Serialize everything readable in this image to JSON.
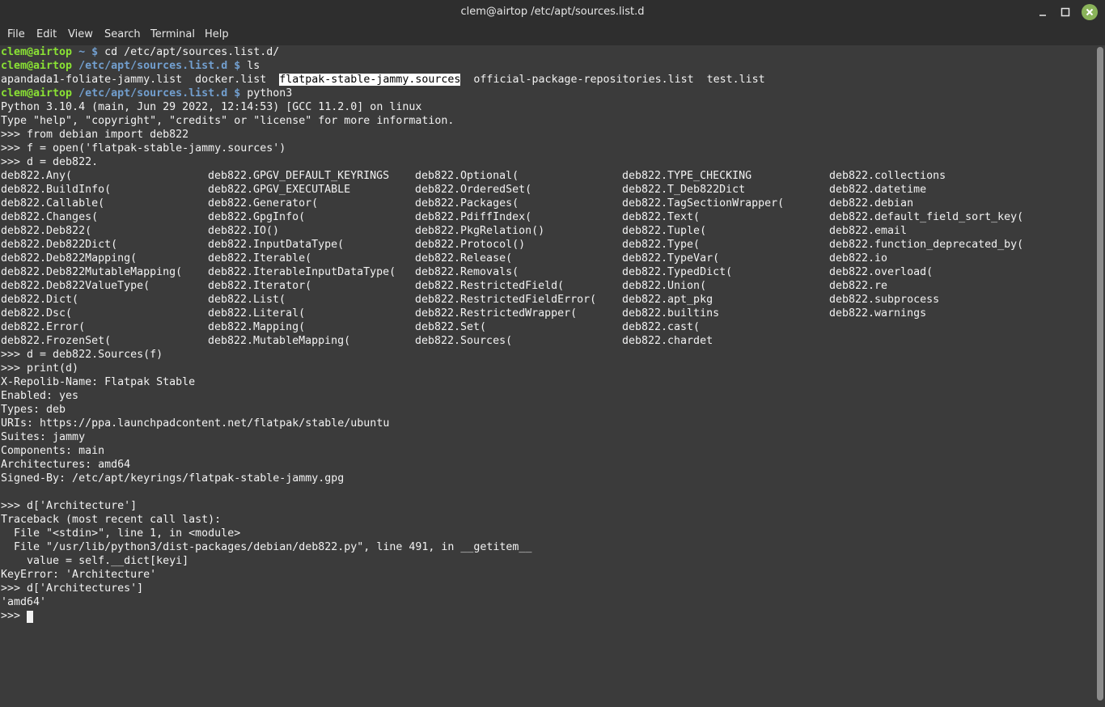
{
  "window": {
    "title": "clem@airtop /etc/apt/sources.list.d"
  },
  "menu": [
    "File",
    "Edit",
    "View",
    "Search",
    "Terminal",
    "Help"
  ],
  "colors": {
    "background": "#3b3b3b",
    "text": "#f2f2f2",
    "prompt_user": "#8ae234",
    "prompt_path": "#729fcf",
    "selection": "#ffffff",
    "close_button": "#8ab35a"
  },
  "icons": [
    "minimize-icon",
    "maximize-icon",
    "close-icon"
  ],
  "terminal": {
    "prompts": [
      {
        "user": "clem@airtop",
        "path": "~",
        "sym": "$",
        "cmd": "cd /etc/apt/sources.list.d/"
      },
      {
        "user": "clem@airtop",
        "path": "/etc/apt/sources.list.d",
        "sym": "$",
        "cmd": "ls"
      },
      {
        "user": "clem@airtop",
        "path": "/etc/apt/sources.list.d",
        "sym": "$",
        "cmd": "python3"
      }
    ],
    "ls_output": [
      "apandada1-foliate-jammy.list",
      "docker.list",
      "flatpak-stable-jammy.sources",
      "official-package-repositories.list",
      "test.list"
    ],
    "python_lines_1": [
      "Python 3.10.4 (main, Jun 29 2022, 12:14:53) [GCC 11.2.0] on linux",
      "Type \"help\", \"copyright\", \"credits\" or \"license\" for more information.",
      ">>> from debian import deb822",
      ">>> f = open('flatpak-stable-jammy.sources')",
      ">>> d = deb822."
    ],
    "completions": [
      [
        "deb822.Any(",
        "deb822.GPGV_DEFAULT_KEYRINGS",
        "deb822.Optional(",
        "deb822.TYPE_CHECKING",
        "deb822.collections"
      ],
      [
        "deb822.BuildInfo(",
        "deb822.GPGV_EXECUTABLE",
        "deb822.OrderedSet(",
        "deb822.T_Deb822Dict",
        "deb822.datetime"
      ],
      [
        "deb822.Callable(",
        "deb822.Generator(",
        "deb822.Packages(",
        "deb822.TagSectionWrapper(",
        "deb822.debian"
      ],
      [
        "deb822.Changes(",
        "deb822.GpgInfo(",
        "deb822.PdiffIndex(",
        "deb822.Text(",
        "deb822.default_field_sort_key("
      ],
      [
        "deb822.Deb822(",
        "deb822.IO()",
        "deb822.PkgRelation()",
        "deb822.Tuple(",
        "deb822.email"
      ],
      [
        "deb822.Deb822Dict(",
        "deb822.InputDataType(",
        "deb822.Protocol()",
        "deb822.Type(",
        "deb822.function_deprecated_by("
      ],
      [
        "deb822.Deb822Mapping(",
        "deb822.Iterable(",
        "deb822.Release(",
        "deb822.TypeVar(",
        "deb822.io"
      ],
      [
        "deb822.Deb822MutableMapping(",
        "deb822.IterableInputDataType(",
        "deb822.Removals(",
        "deb822.TypedDict(",
        "deb822.overload("
      ],
      [
        "deb822.Deb822ValueType(",
        "deb822.Iterator(",
        "deb822.RestrictedField(",
        "deb822.Union(",
        "deb822.re"
      ],
      [
        "deb822.Dict(",
        "deb822.List(",
        "deb822.RestrictedFieldError(",
        "deb822.apt_pkg",
        "deb822.subprocess"
      ],
      [
        "deb822.Dsc(",
        "deb822.Literal(",
        "deb822.RestrictedWrapper(",
        "deb822.builtins",
        "deb822.warnings"
      ],
      [
        "deb822.Error(",
        "deb822.Mapping(",
        "deb822.Set(",
        "deb822.cast(",
        ""
      ],
      [
        "deb822.FrozenSet(",
        "deb822.MutableMapping(",
        "deb822.Sources(",
        "deb822.chardet",
        ""
      ]
    ],
    "python_lines_2": [
      ">>> d = deb822.Sources(f)",
      ">>> print(d)",
      "X-Repolib-Name: Flatpak Stable",
      "Enabled: yes",
      "Types: deb",
      "URIs: https://ppa.launchpadcontent.net/flatpak/stable/ubuntu",
      "Suites: jammy",
      "Components: main",
      "Architectures: amd64",
      "Signed-By: /etc/apt/keyrings/flatpak-stable-jammy.gpg",
      "",
      ">>> d['Architecture']",
      "Traceback (most recent call last):",
      "  File \"<stdin>\", line 1, in <module>",
      "  File \"/usr/lib/python3/dist-packages/debian/deb822.py\", line 491, in __getitem__",
      "    value = self.__dict[keyi]",
      "KeyError: 'Architecture'",
      ">>> d['Architectures']",
      "'amd64'"
    ],
    "final_prompt": ">>> "
  }
}
